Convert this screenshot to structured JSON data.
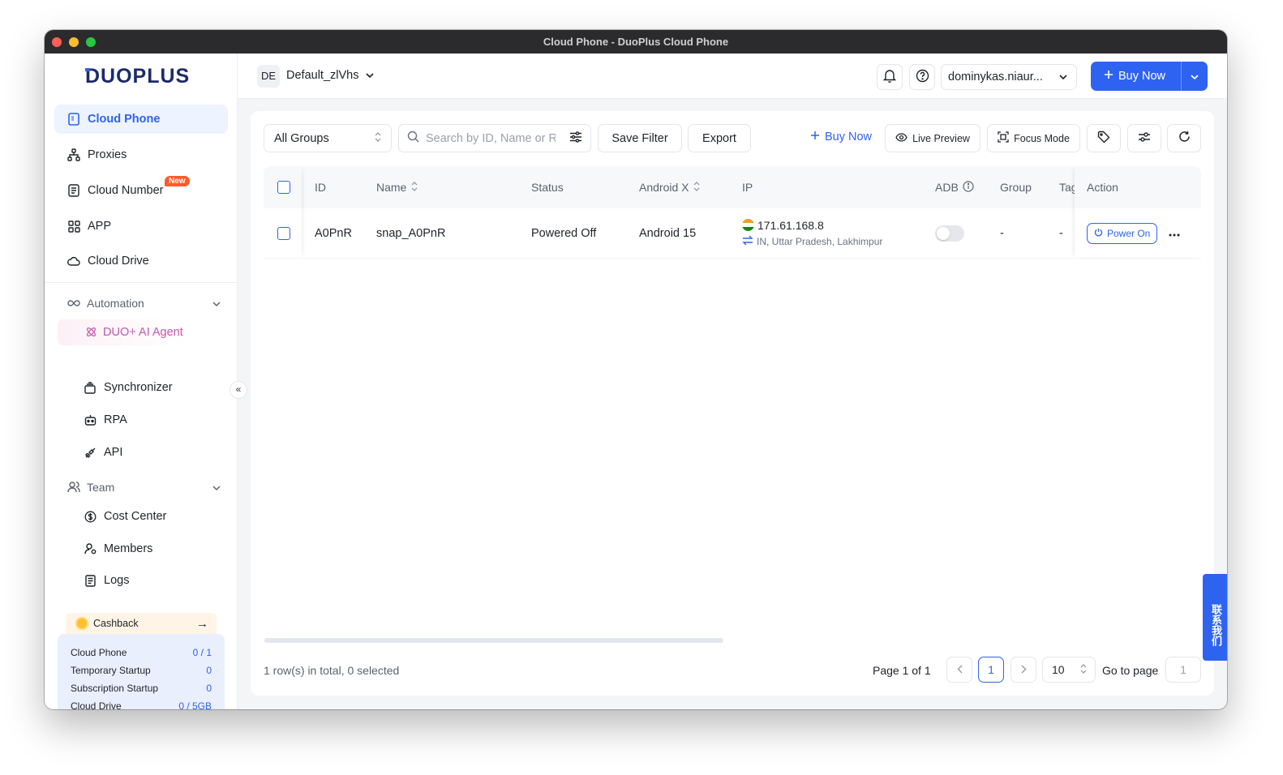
{
  "window": {
    "title": "Cloud Phone - DuoPlus Cloud Phone"
  },
  "brand": {
    "logo_text": "DUOPLUS",
    "accent": "#2e63f2"
  },
  "sidebar": {
    "nav": [
      {
        "label": "Cloud Phone",
        "icon": "phone-icon",
        "active": true
      },
      {
        "label": "Proxies",
        "icon": "network-icon"
      },
      {
        "label": "Cloud Number",
        "icon": "document-icon",
        "badge": "New"
      },
      {
        "label": "APP",
        "icon": "grid-icon"
      },
      {
        "label": "Cloud Drive",
        "icon": "cloud-icon"
      }
    ],
    "automation": {
      "label": "Automation",
      "items": [
        {
          "label": "DUO+ AI Agent",
          "icon": "atom-icon"
        },
        {
          "label": "Synchronizer",
          "icon": "layers-icon"
        },
        {
          "label": "RPA",
          "icon": "robot-icon"
        },
        {
          "label": "API",
          "icon": "plug-icon"
        }
      ]
    },
    "team": {
      "label": "Team",
      "items": [
        {
          "label": "Cost Center",
          "icon": "dollar-icon"
        },
        {
          "label": "Members",
          "icon": "members-icon"
        },
        {
          "label": "Logs",
          "icon": "logs-icon"
        }
      ]
    },
    "cashback": {
      "label": "Cashback"
    },
    "quota": [
      {
        "label": "Cloud Phone",
        "value": "0 / 1"
      },
      {
        "label": "Temporary Startup",
        "value": "0"
      },
      {
        "label": "Subscription Startup",
        "value": "0"
      },
      {
        "label": "Cloud Drive",
        "value": "0 / 5GB"
      }
    ]
  },
  "header": {
    "workspace_initials": "DE",
    "workspace_name": "Default_zlVhs",
    "user": "dominykas.niaur...",
    "buy_now": "Buy Now"
  },
  "toolbar": {
    "group_select": "All Groups",
    "search_placeholder": "Search by ID, Name or Remark",
    "save_filter": "Save Filter",
    "export": "Export",
    "buy_now": "Buy Now",
    "live_preview": "Live Preview",
    "focus_mode": "Focus Mode"
  },
  "table": {
    "columns": [
      "ID",
      "Name",
      "Status",
      "Android X",
      "IP",
      "ADB",
      "Group",
      "Tag",
      "Action"
    ],
    "rows": [
      {
        "id": "A0PnR",
        "name": "snap_A0PnR",
        "status": "Powered Off",
        "android": "Android 15",
        "ip": "171.61.168.8",
        "location": "IN, Uttar Pradesh, Lakhimpur",
        "group": "-",
        "tag": "-",
        "action": "Power On"
      }
    ]
  },
  "footer": {
    "total": "1 row(s) in total, 0 selected",
    "page_info": "Page 1 of 1",
    "current_page": "1",
    "page_size": "10",
    "goto_label": "Go to page",
    "goto_value": "1"
  },
  "contact_tab": "联系我们"
}
